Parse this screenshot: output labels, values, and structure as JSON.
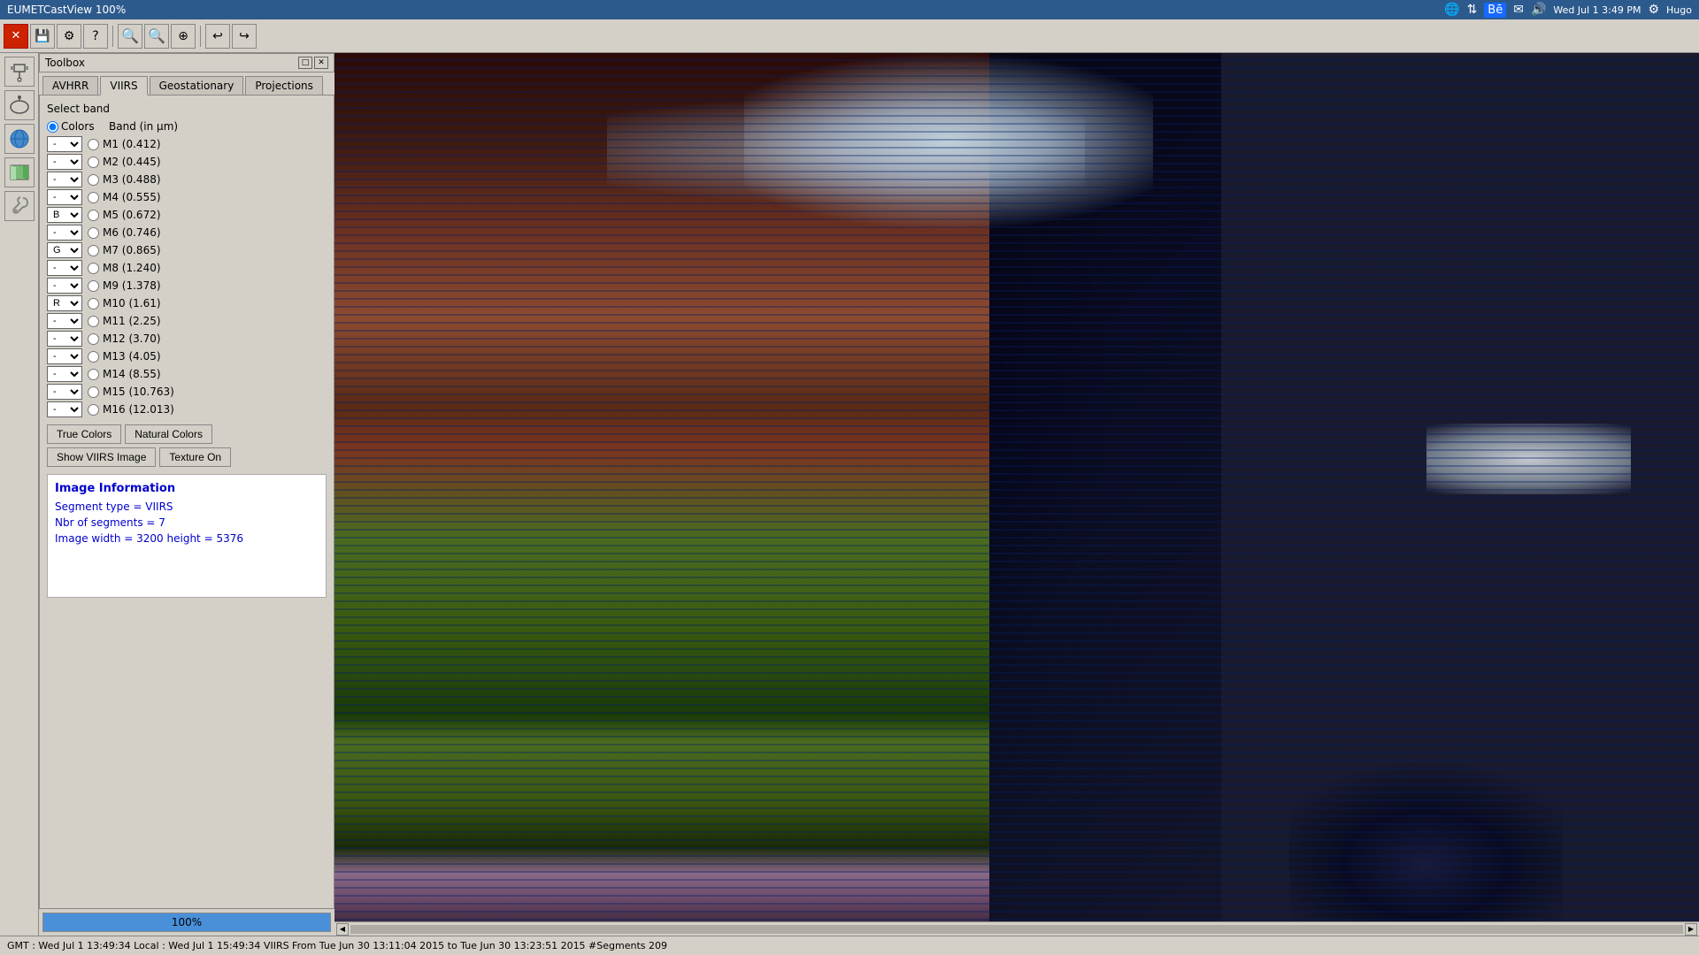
{
  "titlebar": {
    "title": "EUMETCastView 100%",
    "right_items": [
      "Wed Jul 1  3:49 PM",
      "Hugo"
    ]
  },
  "toolbar": {
    "buttons": [
      "🔴",
      "💾",
      "🔧",
      "❓",
      "🔍-",
      "🔍+",
      "⊕",
      "↩",
      "↪"
    ]
  },
  "toolbox": {
    "title": "Toolbox",
    "tabs": [
      {
        "id": "avhrr",
        "label": "AVHRR"
      },
      {
        "id": "viirs",
        "label": "VIIRS",
        "active": true
      },
      {
        "id": "geostationary",
        "label": "Geostationary"
      },
      {
        "id": "projections",
        "label": "Projections"
      }
    ],
    "select_band_label": "Select band",
    "band_column_colors": "Colors",
    "band_column_band": "Band (in μm)",
    "bands": [
      {
        "dropdown": "-",
        "band": "M1 (0.412)"
      },
      {
        "dropdown": "-",
        "band": "M2 (0.445)"
      },
      {
        "dropdown": "-",
        "band": "M3 (0.488)"
      },
      {
        "dropdown": "-",
        "band": "M4 (0.555)"
      },
      {
        "dropdown": "B",
        "band": "M5 (0.672)"
      },
      {
        "dropdown": "-",
        "band": "M6 (0.746)"
      },
      {
        "dropdown": "G",
        "band": "M7 (0.865)"
      },
      {
        "dropdown": "-",
        "band": "M8 (1.240)"
      },
      {
        "dropdown": "-",
        "band": "M9 (1.378)"
      },
      {
        "dropdown": "R",
        "band": "M10 (1.61)"
      },
      {
        "dropdown": "-",
        "band": "M11 (2.25)"
      },
      {
        "dropdown": "-",
        "band": "M12 (3.70)"
      },
      {
        "dropdown": "-",
        "band": "M13 (4.05)"
      },
      {
        "dropdown": "-",
        "band": "M14 (8.55)"
      },
      {
        "dropdown": "-",
        "band": "M15 (10.763)"
      },
      {
        "dropdown": "-",
        "band": "M16 (12.013)"
      }
    ],
    "buttons": {
      "true_colors": "True Colors",
      "natural_colors": "Natural Colors",
      "show_viirs": "Show VIIRS Image",
      "texture_on": "Texture On"
    },
    "image_info": {
      "title": "Image Information",
      "segment_type": "Segment type = VIIRS",
      "nbr_segments": "Nbr of segments = 7",
      "image_size": "Image width = 3200 height = 5376"
    },
    "progress": "100%"
  },
  "statusbar": {
    "text": "GMT : Wed Jul  1 13:49:34    Local : Wed Jul  1 15:49:34   VIIRS From Tue Jun 30 13:11:04 2015 to Tue Jun 30 13:23:51 2015  #Segments 209"
  },
  "icons": {
    "toolbox_icon1": "🛰",
    "toolbox_icon2": "📡",
    "toolbox_icon3": "🌍",
    "toolbox_icon4": "🗺",
    "toolbox_icon5": "🔧"
  }
}
